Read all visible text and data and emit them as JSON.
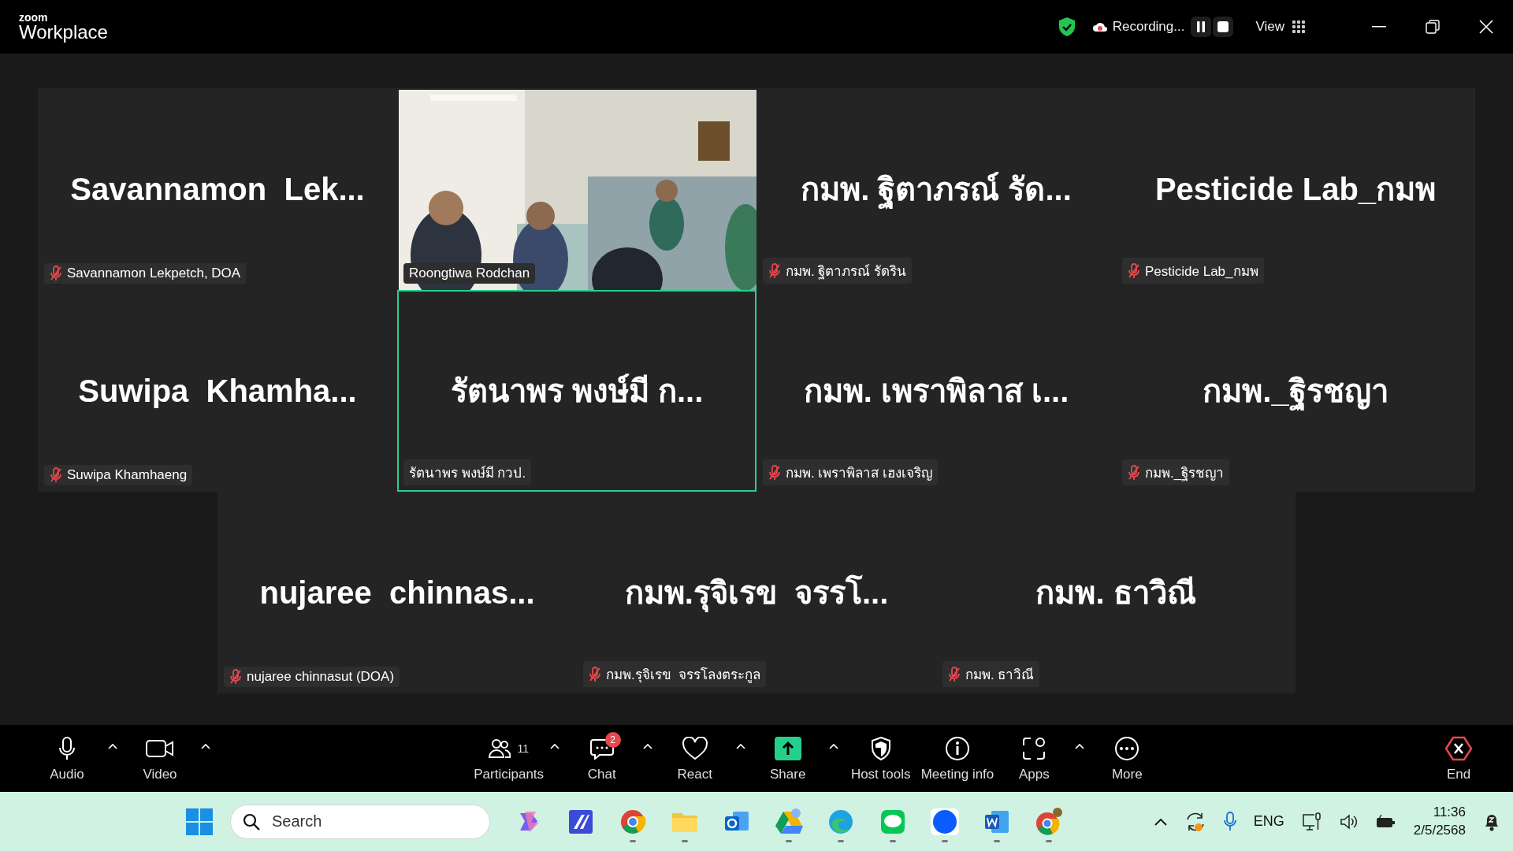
{
  "window": {
    "logo_small": "zoom",
    "logo": "Workplace",
    "recording": "Recording...",
    "view": "View"
  },
  "tiles": [
    {
      "name": "Savannamon  Lek...",
      "label": "Savannamon Lekpetch, DOA",
      "muted": true,
      "kind": "avatar",
      "speaking": false
    },
    {
      "label": "Roongtiwa Rodchan",
      "muted": false,
      "kind": "video",
      "speaking": false
    },
    {
      "name": "กมพ. ฐิตาภรณ์ รัด...",
      "label": "กมพ. ฐิตาภรณ์ รัดริน",
      "muted": true,
      "kind": "avatar",
      "speaking": false
    },
    {
      "name": "Pesticide Lab_กมพ",
      "label": "Pesticide Lab_กมพ",
      "muted": true,
      "kind": "avatar",
      "speaking": false
    },
    {
      "name": "Suwipa  Khamha...",
      "label": "Suwipa Khamhaeng",
      "muted": true,
      "kind": "avatar",
      "speaking": false
    },
    {
      "name": "รัตนาพร พงษ์มี ก...",
      "label": "รัตนาพร พงษ์มี กวป.",
      "muted": false,
      "kind": "avatar",
      "speaking": true
    },
    {
      "name": "กมพ. เพราพิลาส เ...",
      "label": "กมพ. เพราพิลาส เฮงเจริญ",
      "muted": true,
      "kind": "avatar",
      "speaking": false
    },
    {
      "name": "กมพ._ฐิรชญา",
      "label": "กมพ._ฐิรชญา",
      "muted": true,
      "kind": "avatar",
      "speaking": false
    },
    {
      "name": "nujaree  chinnas...",
      "label": "nujaree chinnasut (DOA)",
      "muted": true,
      "kind": "avatar",
      "speaking": false
    },
    {
      "name": "กมพ.รุจิเรข  จรรโ...",
      "label": "กมพ.รุจิเรข  จรรโลงตระกูล",
      "muted": true,
      "kind": "avatar",
      "speaking": false
    },
    {
      "name": "กมพ. ธาวิณี",
      "label": "กมพ. ธาวิณี",
      "muted": true,
      "kind": "avatar",
      "speaking": false
    }
  ],
  "toolbar": [
    {
      "kind": "audio",
      "label": "Audio",
      "menu": true
    },
    {
      "kind": "video",
      "label": "Video",
      "menu": true
    },
    {
      "kind": "participants",
      "label": "Participants",
      "count": "11",
      "menu": true
    },
    {
      "kind": "chat",
      "label": "Chat",
      "badge": "2",
      "menu": true
    },
    {
      "kind": "react",
      "label": "React",
      "menu": true
    },
    {
      "kind": "share",
      "label": "Share",
      "menu": true
    },
    {
      "kind": "host",
      "label": "Host tools",
      "menu": false
    },
    {
      "kind": "info",
      "label": "Meeting info",
      "menu": false
    },
    {
      "kind": "apps",
      "label": "Apps",
      "menu": true
    },
    {
      "kind": "more",
      "label": "More",
      "menu": false
    },
    {
      "kind": "end",
      "label": "End",
      "menu": false
    }
  ],
  "taskbar": {
    "search": {
      "placeholder": "Search"
    },
    "language": "ENG",
    "time": "11:36",
    "date": "2/5/2568"
  }
}
